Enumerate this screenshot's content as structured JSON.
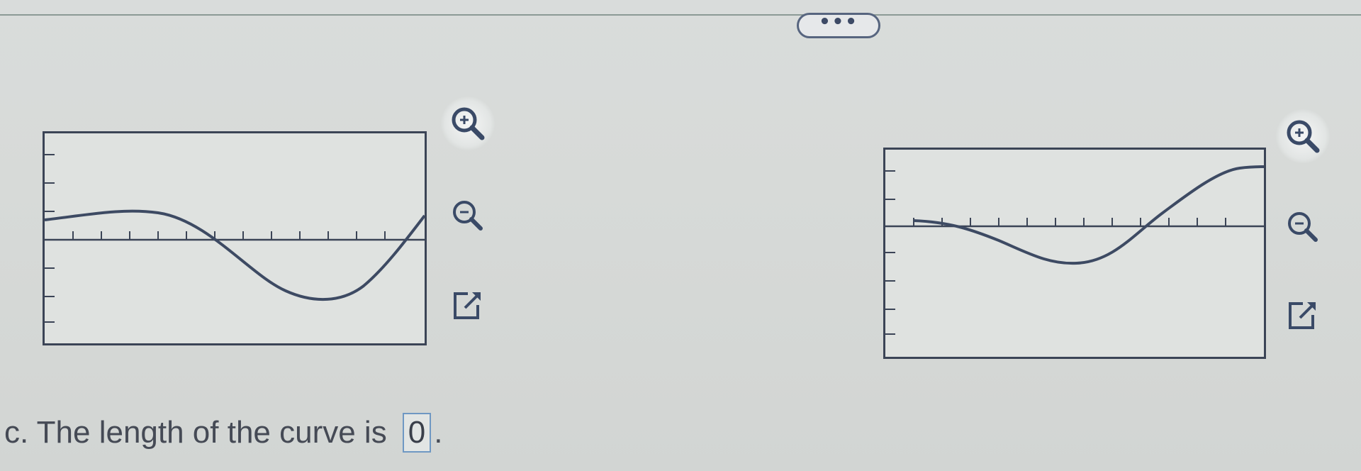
{
  "divider": {
    "more_label": "•••"
  },
  "graphs": [
    {
      "name": "graph-left",
      "curve_color": "#3d4a63",
      "axis_color": "#3b4456"
    },
    {
      "name": "graph-right",
      "curve_color": "#3d4a63",
      "axis_color": "#3b4456"
    }
  ],
  "tools": {
    "zoom_in_icon": "magnifier-plus",
    "zoom_out_icon": "magnifier-minus",
    "popout_icon": "external-link"
  },
  "question": {
    "label": "c. The length of the curve is",
    "answer_value": "0",
    "trailing": "."
  },
  "colors": {
    "icon_blue": "#3a4a67",
    "answer_border": "#6f98c3",
    "panel_border": "#3b4456"
  }
}
